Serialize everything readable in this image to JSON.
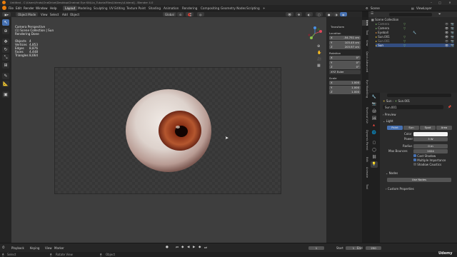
{
  "title_bar": {
    "path": "Untitled - C:\\Users\\Ynds\\OneDrive\\Desktop\\Oneirad Eye Kit\\Lia_TutorialFiles\\Udemy\\4.blend] - Blender 4.0"
  },
  "menu": [
    "File",
    "Edit",
    "Render",
    "Window",
    "Help"
  ],
  "workspaces": [
    "Layout",
    "Modeling",
    "Sculpting",
    "UV Editing",
    "Texture Paint",
    "Shading",
    "Animation",
    "Rendering",
    "Compositing",
    "Geometry Nodes",
    "Scripting"
  ],
  "active_workspace": "Layout",
  "scene": {
    "name": "Scene",
    "view_layer": "ViewLayer"
  },
  "viewport_header": {
    "mode": "Object Mode",
    "items": [
      "View",
      "Select",
      "Add",
      "Object"
    ],
    "orientation": "Global",
    "options_label": "Options"
  },
  "viewport_overlay": {
    "view_name": "Camera Perspective",
    "collection": "(1) Scene Collection | Sun",
    "status": "Rendering Done",
    "stats": [
      {
        "label": "Objects",
        "value": "4"
      },
      {
        "label": "Vertices",
        "value": "4,853"
      },
      {
        "label": "Edges",
        "value": "8,876"
      },
      {
        "label": "Faces",
        "value": "4,448"
      },
      {
        "label": "Triangles",
        "value": "8,664"
      }
    ]
  },
  "transform_panel": {
    "title": "Transform",
    "location_label": "Location",
    "location": [
      {
        "axis": "X",
        "value": "-54.751 cm"
      },
      {
        "axis": "Y",
        "value": "103.45 cm"
      },
      {
        "axis": "Z",
        "value": "203.97 cm"
      }
    ],
    "rotation_label": "Rotation",
    "rotation": [
      {
        "axis": "X",
        "value": "0°"
      },
      {
        "axis": "Y",
        "value": "0°"
      },
      {
        "axis": "Z",
        "value": "0°"
      }
    ],
    "rotation_mode": "XYZ Euler",
    "scale_label": "Scale",
    "scale": [
      {
        "axis": "X",
        "value": "1.000"
      },
      {
        "axis": "Y",
        "value": "1.000"
      },
      {
        "axis": "Z",
        "value": "1.000"
      }
    ]
  },
  "n_tabs": [
    "Item",
    "Tool",
    "View",
    "Quick Advanced",
    "Eye Modelling",
    "Shortcut VUr",
    "Dynamic Parent",
    "Edit",
    "Animate",
    "Tool"
  ],
  "outliner": {
    "title": "Scene Collection",
    "items": [
      "Camera",
      "Camera",
      "Eyeball",
      "Sun.001",
      "Sun.001",
      "Sun"
    ]
  },
  "properties": {
    "breadcrumb_object": "Sun",
    "breadcrumb_data": "Sun.001",
    "data_name": "Sun.001",
    "preview_label": "Preview",
    "light_label": "Light",
    "light_types": [
      "Point",
      "Sun",
      "Spot",
      "Area"
    ],
    "active_light_type": "Point",
    "fields": [
      {
        "label": "Color",
        "value": ""
      },
      {
        "label": "Power",
        "value": "3 W"
      },
      {
        "label": "Radius",
        "value": "0 m"
      },
      {
        "label": "Max Bounces",
        "value": "1024"
      }
    ],
    "checkboxes": [
      {
        "label": "Cast Shadow",
        "checked": true
      },
      {
        "label": "Multiple Importance",
        "checked": true
      },
      {
        "label": "Shadow Caustics",
        "checked": false
      }
    ],
    "nodes_label": "Nodes",
    "use_nodes_label": "Use Nodes",
    "custom_props_label": "Custom Properties"
  },
  "timeline": {
    "items": [
      "Playback",
      "Keying",
      "View",
      "Marker"
    ],
    "current_frame": "1",
    "start_label": "Start",
    "start": "1",
    "end_label": "End",
    "end": "250"
  },
  "status_bar": {
    "items": [
      "Select",
      "Rotate View",
      "Object"
    ]
  },
  "watermark": "Udemy"
}
